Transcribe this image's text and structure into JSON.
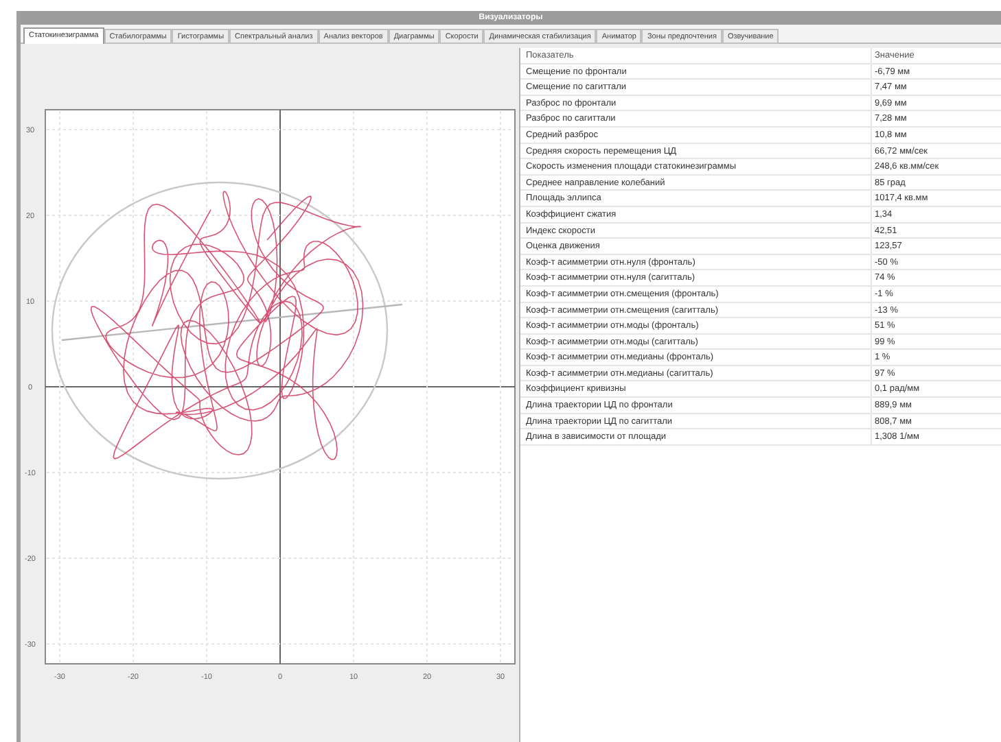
{
  "window": {
    "title": "Визуализаторы"
  },
  "tabs": [
    {
      "label": "Статокинезиграмма",
      "selected": true
    },
    {
      "label": "Стабилограммы",
      "selected": false
    },
    {
      "label": "Гистограммы",
      "selected": false
    },
    {
      "label": "Спектральный анализ",
      "selected": false
    },
    {
      "label": "Анализ векторов",
      "selected": false
    },
    {
      "label": "Диаграммы",
      "selected": false
    },
    {
      "label": "Скорости",
      "selected": false
    },
    {
      "label": "Динамическая стабилизация",
      "selected": false
    },
    {
      "label": "Аниматор",
      "selected": false
    },
    {
      "label": "Зоны предпочтения",
      "selected": false
    },
    {
      "label": "Озвучивание",
      "selected": false
    }
  ],
  "plot": {
    "x_ticks": [
      "-30",
      "-20",
      "-10",
      "0",
      "10",
      "20",
      "30"
    ],
    "y_ticks": [
      "30",
      "20",
      "10",
      "0",
      "-10",
      "-20",
      "-30"
    ]
  },
  "table": {
    "columns": [
      "Показатель",
      "Значение"
    ],
    "rows": [
      [
        "Смещение по фронтали",
        "-6,79 мм"
      ],
      [
        "Смещение по сагиттали",
        "7,47 мм"
      ],
      [
        "Разброс по фронтали",
        "9,69 мм"
      ],
      [
        "Разброс по сагиттали",
        "7,28 мм"
      ],
      [
        "Средний разброс",
        "10,8 мм"
      ],
      [
        "Средняя скорость перемещения ЦД",
        "66,72 мм/сек"
      ],
      [
        "Скорость изменения площади статокинезиграммы",
        "248,6 кв.мм/сек"
      ],
      [
        "Среднее направление колебаний",
        "85 град"
      ],
      [
        "Площадь эллипса",
        "1017,4 кв.мм"
      ],
      [
        "Коэффициент сжатия",
        "1,34"
      ],
      [
        "Индекс скорости",
        "42,51"
      ],
      [
        "Оценка движения",
        "123,57"
      ],
      [
        "Коэф-т асимметрии отн.нуля (фронталь)",
        "-50 %"
      ],
      [
        "Коэф-т асимметрии отн.нуля (сагитталь)",
        "74 %"
      ],
      [
        "Коэф-т асимметрии отн.смещения (фронталь)",
        "-1 %"
      ],
      [
        "Коэф-т асимметрии отн.смещения (сагитталь)",
        "-13 %"
      ],
      [
        "Коэф-т асимметрии отн.моды (фронталь)",
        "51 %"
      ],
      [
        "Коэф-т асимметрии отн.моды (сагитталь)",
        "99 %"
      ],
      [
        "Коэф-т асимметрии отн.медианы (фронталь)",
        "1 %"
      ],
      [
        "Коэф-т асимметрии отн.медианы (сагитталь)",
        "97 %"
      ],
      [
        "Коэффициент кривизны",
        "0,1 рад/мм"
      ],
      [
        "Длина траектории ЦД по фронтали",
        "889,9 мм"
      ],
      [
        "Длина траектории ЦД по сагиттали",
        "808,7 мм"
      ],
      [
        "Длина в зависимости от площади",
        "1,308 1/мм"
      ]
    ]
  }
}
